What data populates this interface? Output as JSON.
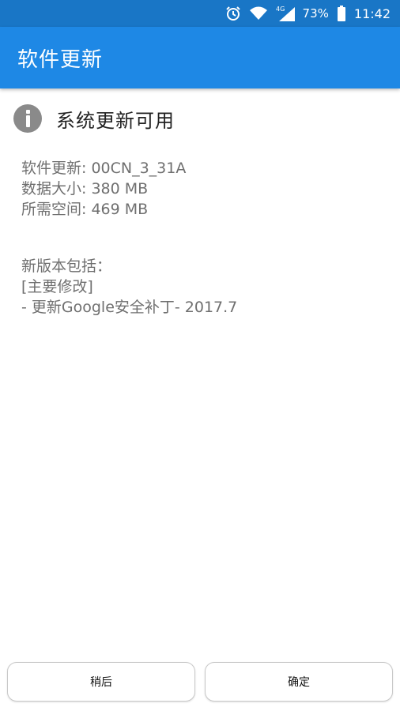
{
  "status_bar": {
    "network": "4G",
    "battery_percent": "73%",
    "time": "11:42"
  },
  "app_bar": {
    "title": "软件更新"
  },
  "update": {
    "heading": "系统更新可用",
    "details": [
      "软件更新: 00CN_3_31A",
      "数据大小: 380 MB",
      "所需空间: 469 MB"
    ],
    "changes": [
      "新版本包括：",
      "[主要修改]",
      "- 更新Google安全补丁- 2017.7"
    ]
  },
  "buttons": {
    "later_label": "稍后",
    "confirm_label": "确定"
  },
  "colors": {
    "status_bar": "#1976c6",
    "app_bar": "#1e88e5"
  }
}
